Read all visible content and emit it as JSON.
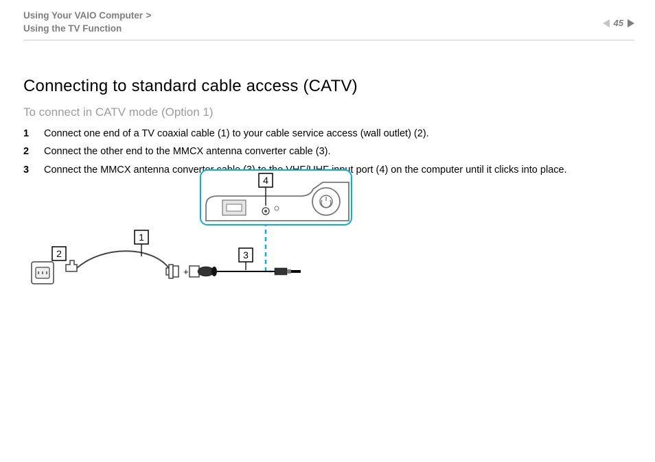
{
  "header": {
    "breadcrumb1": "Using Your VAIO Computer",
    "breadcrumb_sep": ">",
    "breadcrumb2": "Using the TV Function",
    "page_number": "45"
  },
  "title": "Connecting to standard cable access (CATV)",
  "subtitle": "To connect in CATV mode (Option 1)",
  "steps": [
    {
      "num": "1",
      "text": "Connect one end of a TV coaxial cable (1) to your cable service access (wall outlet) (2)."
    },
    {
      "num": "2",
      "text": "Connect the other end to the MMCX antenna converter cable (3)."
    },
    {
      "num": "3",
      "text": "Connect the MMCX antenna converter cable (3) to the VHF/UHF input port (4) on the computer until it clicks into place."
    }
  ],
  "callouts": {
    "c1": "1",
    "c2": "2",
    "c3": "3",
    "c4": "4"
  }
}
